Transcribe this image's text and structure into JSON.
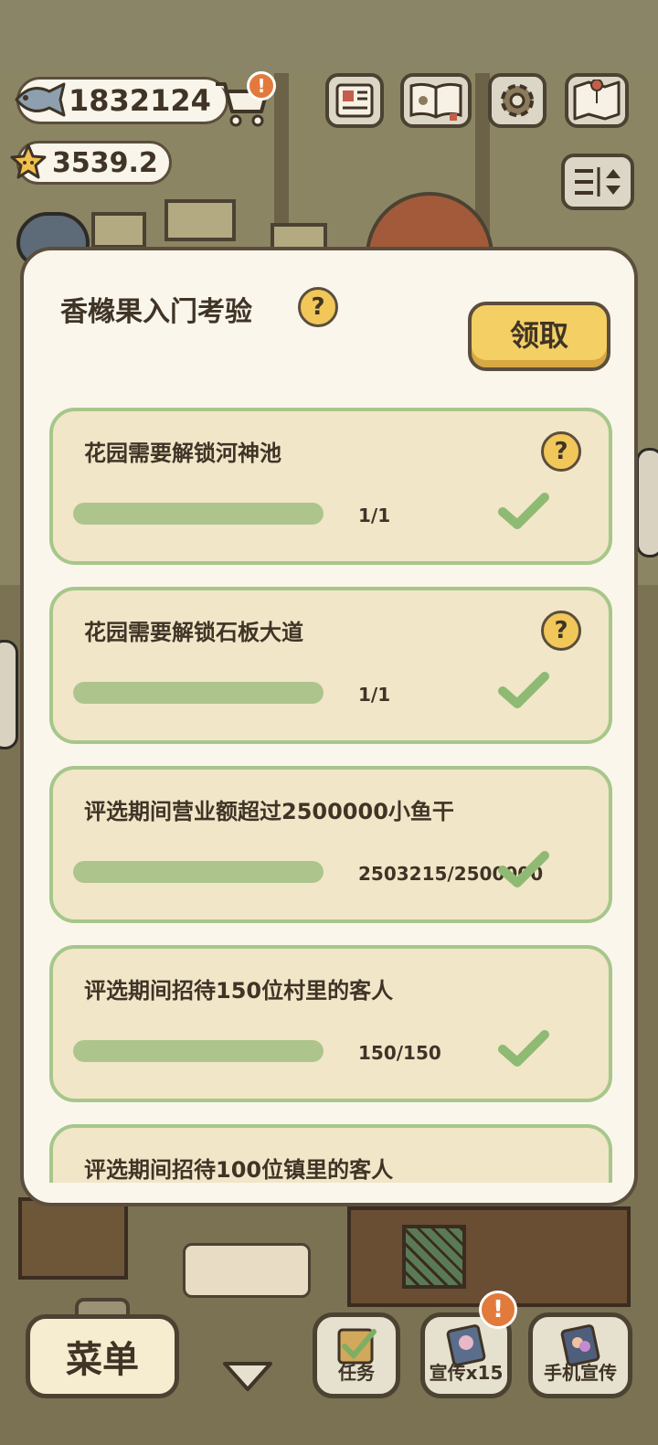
{
  "hud": {
    "fish_count": "1832124",
    "star_count": "3539.2",
    "cart_badge": "!"
  },
  "modal": {
    "title": "香橼果入门考验",
    "help_symbol": "?",
    "claim_label": "领取",
    "tasks": [
      {
        "title": "花园需要解锁河神池",
        "progress": "1/1",
        "fraction": 1.0,
        "completed": true
      },
      {
        "title": "花园需要解锁石板大道",
        "progress": "1/1",
        "fraction": 1.0,
        "completed": true
      },
      {
        "title": "评选期间营业额超过2500000小鱼干",
        "progress": "2503215/2500000",
        "fraction": 1.0,
        "completed": true
      },
      {
        "title": "评选期间招待150位村里的客人",
        "progress": "150/150",
        "fraction": 1.0,
        "completed": true
      },
      {
        "title": "评选期间招待100位镇里的客人"
      }
    ]
  },
  "bottom_bar": {
    "menu_label": "菜单",
    "tasks_label": "任务",
    "promo_label": "宣传x15",
    "promo_badge": "!",
    "phone_promo_label": "手机宣传"
  },
  "colors": {
    "panel_bg": "#fbf6ec",
    "task_card_bg": "#f1e6c8",
    "task_card_border": "#a6c78a",
    "progress_fill": "#aec48d",
    "check_green": "#8fba74",
    "claim_button": "#f4cf64",
    "outline": "#5b4e3d"
  },
  "icons": {
    "fish": "fish-icon",
    "star": "star-icon",
    "cart": "cart-icon",
    "news": "newspaper-icon",
    "catbook": "paw-book-icon",
    "settings": "gear-icon",
    "map": "map-icon",
    "sort": "sort-icon",
    "check": "check-icon",
    "help": "question-icon"
  }
}
